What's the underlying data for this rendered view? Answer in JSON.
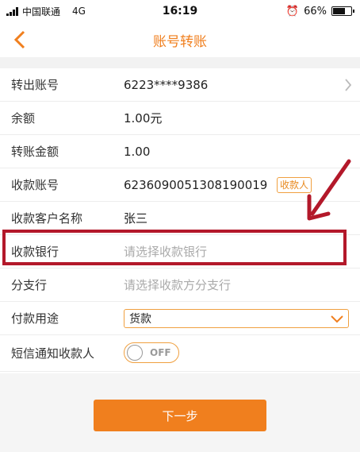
{
  "status_bar": {
    "carrier": "中国联通",
    "network": "4G",
    "time": "16:19",
    "battery": "66%",
    "battery_level": 0.66
  },
  "nav": {
    "title": "账号转账"
  },
  "form": {
    "from_account": {
      "label": "转出账号",
      "value": "6223****9386"
    },
    "balance": {
      "label": "余额",
      "value": "1.00元"
    },
    "amount": {
      "label": "转账金额",
      "value": "1.00"
    },
    "payee_account": {
      "label": "收款账号",
      "value": "6236090051308190019",
      "tag": "收款人"
    },
    "payee_name": {
      "label": "收款客户名称",
      "value": "张三"
    },
    "payee_bank": {
      "label": "收款银行",
      "placeholder": "请选择收款银行"
    },
    "branch": {
      "label": "分支行",
      "placeholder": "请选择收款方分支行"
    },
    "purpose": {
      "label": "付款用途",
      "selected": "货款"
    },
    "sms_notify": {
      "label": "短信通知收款人",
      "state": "OFF"
    }
  },
  "next_button": {
    "label": "下一步"
  },
  "colors": {
    "accent": "#f07f1e",
    "highlight": "#b3182a"
  },
  "icons": {
    "back": "chevron-left-icon",
    "row_chevron": "chevron-right-icon",
    "select_arrow": "chevron-down-icon",
    "annotation": "arrow-icon"
  }
}
